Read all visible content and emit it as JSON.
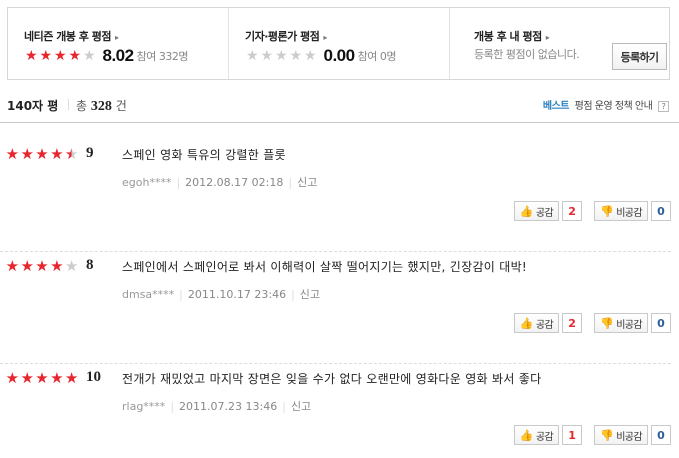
{
  "summary": {
    "netizen": {
      "title": "네티즌 개봉 후 평점",
      "score": "8.02",
      "participants": "참여 332명",
      "star_rating": 4
    },
    "critic": {
      "title": "기자·평론가 평점",
      "score": "0.00",
      "participants": "참여 0명",
      "star_rating": 0
    },
    "mine": {
      "title": "개봉 후 내 평점",
      "notice": "등록한 평점이 없습니다.",
      "register_label": "등록하기"
    },
    "arrow": "▸"
  },
  "header": {
    "title": "140자 평",
    "total_label": "총",
    "total_count": "328",
    "total_unit": "건",
    "best_label": "베스트",
    "policy_label": "평점 운영 정책 안내",
    "help_mark": "?"
  },
  "vote_labels": {
    "like": "공감",
    "dislike": "비공감"
  },
  "reviews": [
    {
      "stars": 4.5,
      "score": "9",
      "text": "스페인 영화 특유의 강렬한 플롯",
      "user": "egoh****",
      "date": "2012.08.17 02:18",
      "report": "신고",
      "likes": "2",
      "dislikes": "0"
    },
    {
      "stars": 4,
      "score": "8",
      "text": "스페인에서 스페인어로 봐서 이해력이 살짝 떨어지기는 했지만, 긴장감이 대박!",
      "user": "dmsa****",
      "date": "2011.10.17 23:46",
      "report": "신고",
      "likes": "2",
      "dislikes": "0"
    },
    {
      "stars": 5,
      "score": "10",
      "text": "전개가 재밌었고 마지막 장면은 잊을 수가 없다 오랜만에 영화다운 영화 봐서 좋다",
      "user": "rlag****",
      "date": "2011.07.23 13:46",
      "report": "신고",
      "likes": "1",
      "dislikes": "0"
    }
  ],
  "colors": {
    "star_on": "#e8262d",
    "star_off": "#cccccc",
    "best": "#2a7fc1",
    "like_count": "#e8262d",
    "dislike_count": "#2a5e9c"
  }
}
